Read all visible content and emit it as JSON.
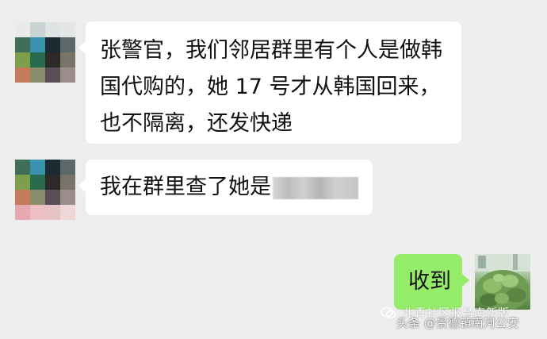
{
  "messages": [
    {
      "sender": "contact",
      "lines": [
        "张警官，我们邻居群里有个人是做韩",
        "国代购的，她 17 号才从韩国回来，",
        "也不隔离，还发快递"
      ]
    },
    {
      "sender": "contact",
      "text": "我在群里查了她是"
    },
    {
      "sender": "self",
      "text": "收到"
    }
  ],
  "watermark": {
    "source": "头条 @景德镇南河公安",
    "overlay": "北青社区报昌南新版"
  },
  "colors": {
    "background": "#ededed",
    "incoming_bubble": "#ffffff",
    "outgoing_bubble": "#95ec69"
  },
  "icons": {
    "contact_avatar": "pixelated-avatar",
    "self_avatar": "plant-photo-avatar",
    "watermark_logo": "wechat-icon",
    "redaction": "blurred-name"
  }
}
